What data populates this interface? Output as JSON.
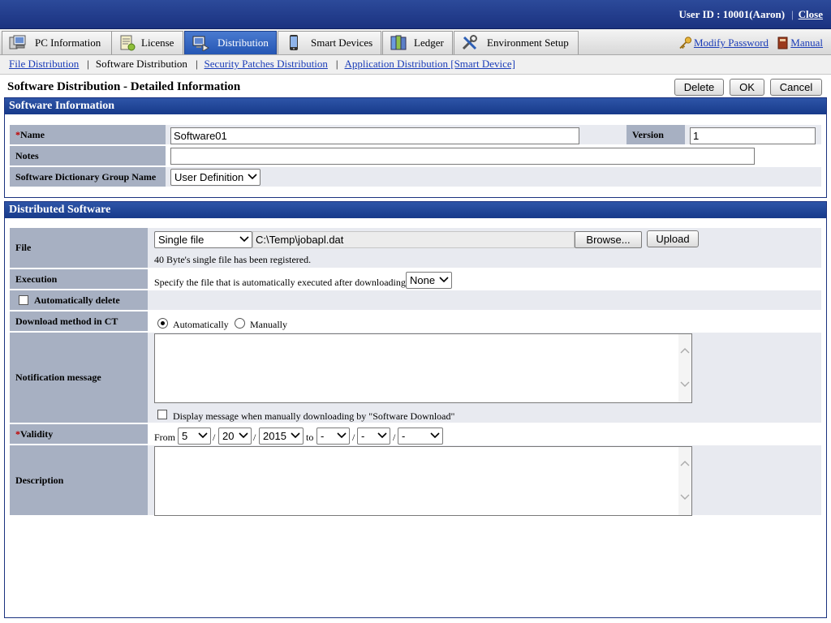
{
  "header": {
    "user_label": "User ID : 10001(Aaron)",
    "close_label": "Close"
  },
  "tabs": [
    {
      "label": "PC Information",
      "icon": "pc-icon"
    },
    {
      "label": "License",
      "icon": "license-icon"
    },
    {
      "label": "Distribution",
      "icon": "distribution-icon",
      "active": true
    },
    {
      "label": "Smart Devices",
      "icon": "smartphone-icon"
    },
    {
      "label": "Ledger",
      "icon": "ledger-icon"
    },
    {
      "label": "Environment Setup",
      "icon": "tools-icon"
    }
  ],
  "right_links": {
    "modify_password": "Modify Password",
    "manual": "Manual"
  },
  "subnav": {
    "file_distribution": "File Distribution",
    "software_distribution": "Software Distribution",
    "security_patches": "Security Patches Distribution",
    "application_distribution": "Application Distribution [Smart Device]"
  },
  "page": {
    "title": "Software Distribution - Detailed Information",
    "delete_label": "Delete",
    "ok_label": "OK",
    "cancel_label": "Cancel"
  },
  "software_info": {
    "heading": "Software Information",
    "required_mark": "*",
    "name_label": "Name",
    "name_value": "Software01",
    "version_label": "Version",
    "version_value": "1",
    "notes_label": "Notes",
    "notes_value": "",
    "dict_group_label": "Software Dictionary Group Name",
    "dict_group_value": "User Definition"
  },
  "distributed": {
    "heading": "Distributed Software",
    "file_label": "File",
    "file_type_value": "Single file",
    "file_path_value": "C:\\Temp\\jobapl.dat",
    "browse_label": "Browse...",
    "upload_label": "Upload",
    "file_note": "40 Byte's single file has been registered.",
    "execution_label": "Execution",
    "execution_text": "Specify the file that is automatically executed after downloading",
    "execution_value": "None",
    "auto_delete_label": "Automatically delete",
    "download_method_label": "Download method in CT",
    "auto_label": "Automatically",
    "manual_label": "Manually",
    "notification_label": "Notification message",
    "notification_value": "",
    "display_msg_label": "Display message when manually downloading by \"Software Download\"",
    "validity_label": "Validity",
    "from_label": "From",
    "to_label": "to",
    "slash": "/",
    "from_month": "5",
    "from_day": "20",
    "from_year": "2015",
    "to_month": "-",
    "to_day": "-",
    "to_year": "-",
    "description_label": "Description",
    "description_value": ""
  },
  "colors": {
    "header_blue": "#1b3280",
    "active_tab": "#2456b4",
    "label_bg": "#a7b0c2",
    "value_bg": "#e8eaf0",
    "link": "#1a3cb8",
    "required": "#c00000"
  }
}
